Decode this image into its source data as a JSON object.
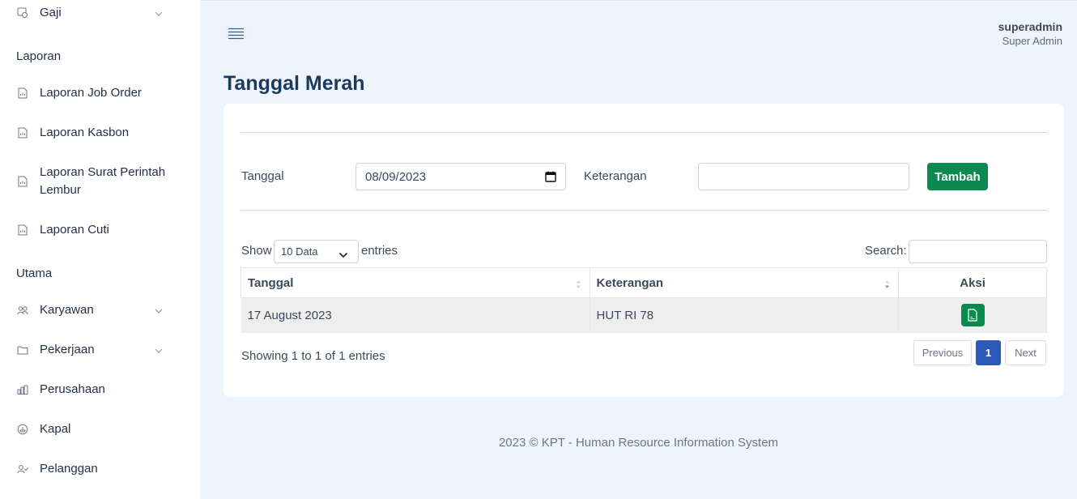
{
  "sidebar": {
    "top_item": {
      "label": "Gaji",
      "icon": "payroll-icon"
    },
    "section_reports": "Laporan",
    "report_items": [
      {
        "label": "Laporan Job Order",
        "icon": "report-icon"
      },
      {
        "label": "Laporan Kasbon",
        "icon": "report-icon"
      },
      {
        "label": "Laporan Surat Perintah Lembur",
        "icon": "report-icon"
      },
      {
        "label": "Laporan Cuti",
        "icon": "report-icon"
      }
    ],
    "section_main": "Utama",
    "main_items": [
      {
        "label": "Karyawan",
        "icon": "users-icon"
      },
      {
        "label": "Pekerjaan",
        "icon": "folder-icon"
      },
      {
        "label": "Perusahaan",
        "icon": "building-icon"
      },
      {
        "label": "Kapal",
        "icon": "ship-icon"
      },
      {
        "label": "Pelanggan",
        "icon": "customer-icon"
      }
    ]
  },
  "header": {
    "user_name": "superadmin",
    "user_role": "Super Admin"
  },
  "page": {
    "title": "Tanggal Merah"
  },
  "form": {
    "date_label": "Tanggal",
    "date_value": "08/09/2023",
    "note_label": "Keterangan",
    "note_value": "",
    "submit_label": "Tambah"
  },
  "table_controls": {
    "show_label": "Show",
    "entries_select": "10 Data",
    "entries_label": "entries",
    "search_label": "Search:",
    "search_value": ""
  },
  "table": {
    "columns": [
      "Tanggal",
      "Keterangan",
      "Aksi"
    ],
    "rows": [
      {
        "tanggal": "17 August 2023",
        "keterangan": "HUT RI 78"
      }
    ]
  },
  "pagination": {
    "info": "Showing 1 to 1 of 1 entries",
    "previous": "Previous",
    "current": "1",
    "next": "Next"
  },
  "footer": {
    "text": "2023 © KPT - Human Resource Information System"
  },
  "colors": {
    "accent_green": "#0b8a4f",
    "page_active": "#2d5ab8",
    "title": "#1c3a5e"
  }
}
